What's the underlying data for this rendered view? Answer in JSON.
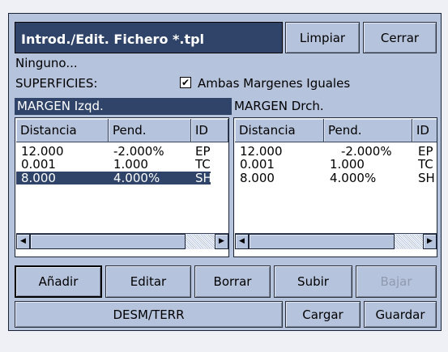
{
  "title": "Introd./Edit. Fichero *.tpl",
  "buttons": {
    "limpiar": "Limpiar",
    "cerrar": "Cerrar",
    "anadir": "Añadir",
    "editar": "Editar",
    "borrar": "Borrar",
    "subir": "Subir",
    "bajar": "Bajar",
    "desm_terr": "DESM/TERR",
    "cargar": "Cargar",
    "guardar": "Guardar"
  },
  "status_text": "Ninguno...",
  "superficies_label": "SUPERFICIES:",
  "checkbox": {
    "label": "Ambas Margenes Iguales",
    "checked": true,
    "mark": "✔"
  },
  "left_panel": {
    "title": "MARGEN Izqd.",
    "columns": [
      "Distancia",
      "Pend.",
      "ID"
    ],
    "rows": [
      [
        "12.000",
        "-2.000%",
        "EP"
      ],
      [
        "0.001",
        "1.000",
        "TC"
      ],
      [
        "8.000",
        "4.000%",
        "SH"
      ]
    ],
    "selected_row": 2
  },
  "right_panel": {
    "title": "MARGEN Drch.",
    "columns": [
      "Distancia",
      "Pend.",
      "ID"
    ],
    "rows": [
      [
        "12.000",
        "-2.000%",
        "EP"
      ],
      [
        "0.001",
        "1.000",
        "TC"
      ],
      [
        "8.000",
        "4.000%",
        "SH"
      ]
    ],
    "selected_row": null
  },
  "scroll_arrows": {
    "left": "◀",
    "right": "▶"
  },
  "colors": {
    "accent": "#2f4468",
    "window": "#b6c3dc",
    "disabled_text": "#8e9ab0"
  }
}
